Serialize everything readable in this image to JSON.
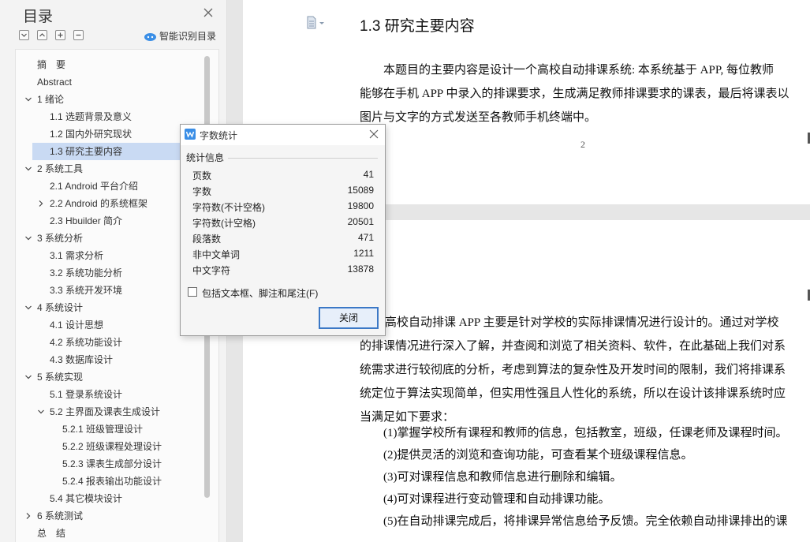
{
  "sidebar": {
    "title": "目录",
    "smart_detect_label": "智能识别目录",
    "toc": [
      {
        "label": "摘　要",
        "level": 0,
        "expander": "none"
      },
      {
        "label": "Abstract",
        "level": 0,
        "expander": "none"
      },
      {
        "label": "1 绪论",
        "level": 0,
        "expander": "expanded"
      },
      {
        "label": "1.1 选题背景及意义",
        "level": 1,
        "expander": "none"
      },
      {
        "label": "1.2 国内外研究现状",
        "level": 1,
        "expander": "none"
      },
      {
        "label": "1.3 研究主要内容",
        "level": 1,
        "expander": "none",
        "selected": true
      },
      {
        "label": "2 系统工具",
        "level": 0,
        "expander": "expanded"
      },
      {
        "label": "2.1 Android 平台介绍",
        "level": 1,
        "expander": "none"
      },
      {
        "label": "2.2 Android 的系统框架",
        "level": 1,
        "expander": "collapsed"
      },
      {
        "label": "2.3 Hbuilder 简介",
        "level": 1,
        "expander": "none"
      },
      {
        "label": "3 系统分析",
        "level": 0,
        "expander": "expanded"
      },
      {
        "label": "3.1 需求分析",
        "level": 1,
        "expander": "none"
      },
      {
        "label": "3.2 系统功能分析",
        "level": 1,
        "expander": "none"
      },
      {
        "label": "3.3 系统开发环境",
        "level": 1,
        "expander": "none"
      },
      {
        "label": "4 系统设计",
        "level": 0,
        "expander": "expanded"
      },
      {
        "label": "4.1 设计思想",
        "level": 1,
        "expander": "none"
      },
      {
        "label": "4.2 系统功能设计",
        "level": 1,
        "expander": "none"
      },
      {
        "label": "4.3 数据库设计",
        "level": 1,
        "expander": "none"
      },
      {
        "label": "5 系统实现",
        "level": 0,
        "expander": "expanded"
      },
      {
        "label": "5.1 登录系统设计",
        "level": 1,
        "expander": "none"
      },
      {
        "label": "5.2 主界面及课表生成设计",
        "level": 1,
        "expander": "expanded"
      },
      {
        "label": "5.2.1 班级管理设计",
        "level": 2,
        "expander": "none"
      },
      {
        "label": "5.2.2 班级课程处理设计",
        "level": 2,
        "expander": "none"
      },
      {
        "label": "5.2.3 课表生成部分设计",
        "level": 2,
        "expander": "none"
      },
      {
        "label": "5.2.4 报表输出功能设计",
        "level": 2,
        "expander": "none"
      },
      {
        "label": "5.4 其它模块设计",
        "level": 1,
        "expander": "none"
      },
      {
        "label": "6 系统测试",
        "level": 0,
        "expander": "collapsed"
      },
      {
        "label": "总　结",
        "level": 0,
        "expander": "none"
      }
    ]
  },
  "document": {
    "heading": "1.3 研究主要内容",
    "page1_paragraph": [
      "　　本题目的主要内容是设计一个高校自动排课系统: 本系统基于 APP, 每位教师",
      "能够在手机 APP 中录入的排课要求，生成满足教师排课要求的课表，最后将课表以",
      "图片与文字的方式发送至各教师手机终端中。"
    ],
    "page_number": "2",
    "page2_paragraph": [
      "高校自动排课 APP 主要是针对学校的实际排课情况进行设计的。通过对学校",
      "的排课情况进行深入了解，并查阅和浏览了相关资料、软件，在此基础上我们对系",
      "统需求进行较彻底的分析，考虑到算法的复杂性及开发时间的限制，我们将排课系",
      "统定位于算法实现简单，但实用性强且人性化的系统，所以在设计该排课系统时应",
      "当满足如下要求："
    ],
    "requirements": [
      "(1)掌握学校所有课程和教师的信息，包括教室，班级，任课老师及课程时间。",
      "(2)提供灵活的浏览和查询功能，可查看某个班级课程信息。",
      "(3)可对课程信息和教师信息进行删除和编辑。",
      "(4)可对课程进行变动管理和自动排课功能。",
      "(5)在自动排课完成后，将排课异常信息给予反馈。完全依赖自动排课排出的课"
    ]
  },
  "dialog": {
    "title": "字数统计",
    "group_label": "统计信息",
    "stats": [
      {
        "key": "页数",
        "value": "41"
      },
      {
        "key": "字数",
        "value": "15089"
      },
      {
        "key": "字符数(不计空格)",
        "value": "19800"
      },
      {
        "key": "字符数(计空格)",
        "value": "20501"
      },
      {
        "key": "段落数",
        "value": "471"
      },
      {
        "key": "非中文单词",
        "value": "1211"
      },
      {
        "key": "中文字符",
        "value": "13878"
      }
    ],
    "checkbox_label": "包括文本框、脚注和尾注(F)",
    "checkbox_checked": false,
    "close_button_label": "关闭"
  },
  "colors": {
    "selected_toc": "#c9daf3",
    "button_border": "#3b78c6",
    "accent_blue": "#3a8ee6"
  }
}
